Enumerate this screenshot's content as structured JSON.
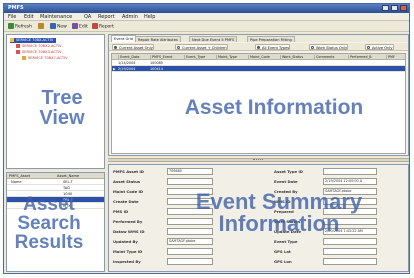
{
  "window": {
    "title": "PMFS"
  },
  "menu": [
    "File",
    "Edit",
    "Maintenance",
    "QA",
    "Report",
    "Admin",
    "Help"
  ],
  "toolbar": [
    {
      "label": "Refresh",
      "icon": "refresh-icon",
      "color": "#3c8a3c"
    },
    {
      "label": "",
      "icon": "filter-icon",
      "color": "#b58a2a"
    },
    {
      "label": "New",
      "icon": "new-icon",
      "color": "#3a62b0"
    },
    {
      "label": "Edit",
      "icon": "edit-icon",
      "color": "#7a4ea3"
    },
    {
      "label": "Report",
      "icon": "report-icon",
      "color": "#c24a3a"
    }
  ],
  "tree": {
    "items": [
      {
        "label": "SERVICE T08X-ACTIV",
        "selected": true
      },
      {
        "label": "SERVICE T08X2-ACTIV",
        "selected": false
      },
      {
        "label": "SERVICE T08X3-ACTIV",
        "selected": false
      },
      {
        "label": "SERVICE T08X7-ACTIV",
        "selected": false
      }
    ]
  },
  "search_results": {
    "columns": [
      "PMFS_Asset",
      "Asset_Name"
    ],
    "rows": [
      {
        "c1": "Name",
        "c2": "SEL-T"
      },
      {
        "c1": "",
        "c2": "TAG"
      },
      {
        "c1": "",
        "c2": "1040"
      },
      {
        "c1": "",
        "c2": "SEL-T"
      },
      {
        "c1": "",
        "c2": "MTX"
      }
    ],
    "selected_row": 3
  },
  "asset": {
    "tabs": [
      "Event Grid",
      "Repair Rate Attributes",
      "Next Due Event 5 PMFS",
      "Pipe Preparation Fitting"
    ],
    "options": [
      {
        "label": "Current Asset Only",
        "on": true
      },
      {
        "label": "Current Asset + Children",
        "on": false
      },
      {
        "label": "All Event Types",
        "on": true
      },
      {
        "label": "Work Status Only",
        "on": false
      },
      {
        "label": "Active Only",
        "on": false
      }
    ],
    "columns": [
      "Event_Date",
      "PMFS_Event",
      "Event_Type",
      "Maint_Type",
      "Maint_Code",
      "Work_Status",
      "Comments",
      "Performed_B",
      "PMF"
    ],
    "rows": [
      {
        "date": "1/14/2004",
        "id": "100085"
      },
      {
        "date": "2/19/2004",
        "id": "100414"
      }
    ],
    "selected_row": 1
  },
  "summary": {
    "left": [
      {
        "label": "PMFS Asset ID",
        "value": "706680"
      },
      {
        "label": "Asset Status",
        "value": ""
      },
      {
        "label": "Maint Code ID",
        "value": ""
      },
      {
        "label": "Create Date",
        "value": ""
      },
      {
        "label": "PMS ID",
        "value": ""
      },
      {
        "label": "Performed By",
        "value": ""
      },
      {
        "label": "Dataw WMS ID",
        "value": ""
      },
      {
        "label": "Updated By",
        "value": "SAMTAGF.ptobe"
      },
      {
        "label": "Maint Type ID",
        "value": ""
      },
      {
        "label": "Inspected By",
        "value": ""
      }
    ],
    "right": [
      {
        "label": "Asset Type ID",
        "value": ""
      },
      {
        "label": "Event Date",
        "value": "2/19/2004 12:00:00 A"
      },
      {
        "label": "Created By",
        "value": "SAMTAGF.ptobe"
      },
      {
        "label": "WMS ID",
        "value": ""
      },
      {
        "label": "Prepared",
        "value": ""
      },
      {
        "label": "Work Status",
        "value": ""
      },
      {
        "label": "Update Date",
        "value": "2/20/2004 1:43:22 AM"
      },
      {
        "label": "Event Type",
        "value": ""
      },
      {
        "label": "GPS Lat",
        "value": ""
      },
      {
        "label": "GPS Lon",
        "value": ""
      }
    ]
  },
  "overlays": {
    "tree": [
      "Tree",
      "View"
    ],
    "asset": "Asset Information",
    "search": [
      "Asset",
      "Search",
      "Results"
    ],
    "event": [
      "Event Summary",
      "Information"
    ]
  },
  "colors": {
    "selection": "#2d50a8",
    "overlay": "#3b5ea8"
  }
}
